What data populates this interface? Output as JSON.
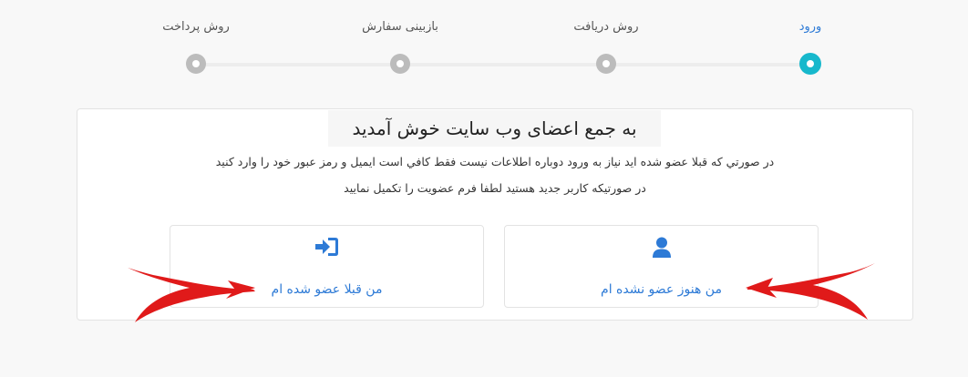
{
  "steps": [
    {
      "label": "ورود",
      "active": true
    },
    {
      "label": "روش دریافت",
      "active": false
    },
    {
      "label": "بازبینی سفارش",
      "active": false
    },
    {
      "label": "روش پرداخت",
      "active": false
    }
  ],
  "card": {
    "title": "به جمع اعضای وب سایت خوش آمدید",
    "line1": "در صورتي که قبلا عضو شده ايد نياز به ورود دوباره اطلاعات نيست فقط کافي است ايميل و رمز عبور خود را وارد کنيد",
    "line2": "در صورتيکه کاربر جديد هستيد لطفا فرم عضويت را تکميل نماييد",
    "new_user_label": "من هنوز عضو نشده ام",
    "member_label": "من قبلا عضو شده ام"
  },
  "colors": {
    "accent": "#2d7ad6",
    "active_step": "#17b8cc",
    "arrow": "#e01a1a"
  },
  "icons": {
    "new_user": "user-icon",
    "member": "sign-in-icon"
  }
}
